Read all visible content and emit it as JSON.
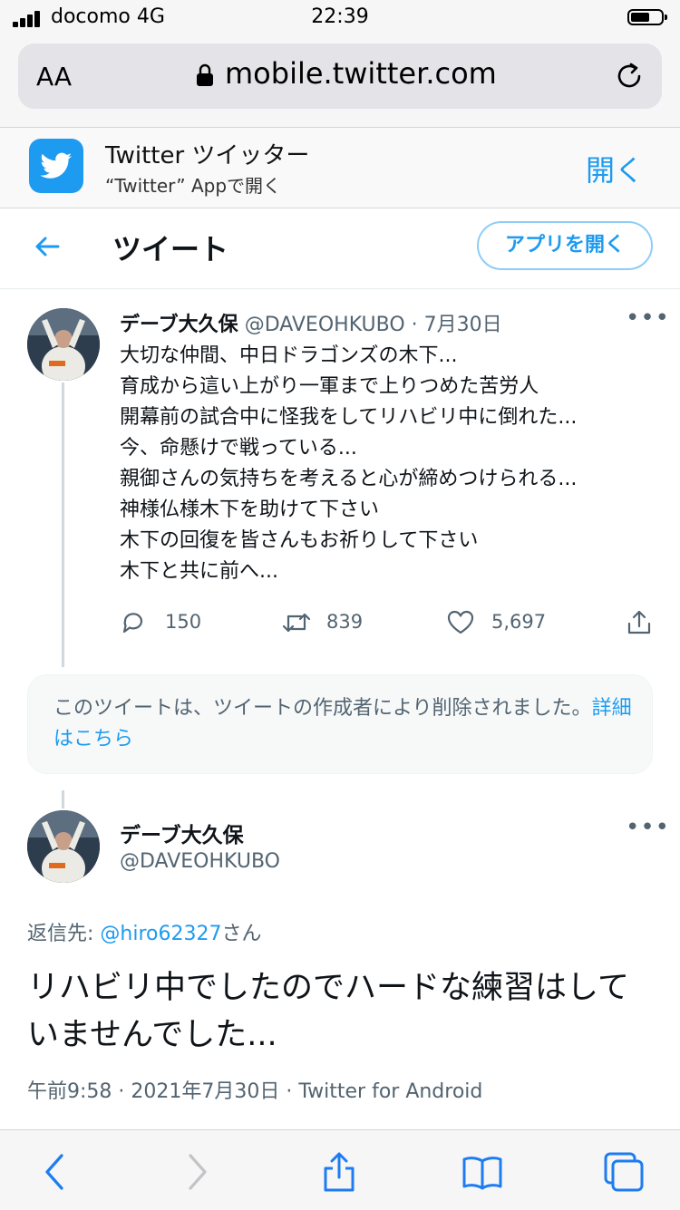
{
  "status": {
    "carrier": "docomo 4G",
    "time": "22:39"
  },
  "safari": {
    "text_size_label": "AA",
    "url": "mobile.twitter.com"
  },
  "app_banner": {
    "name": "Twitter ツイッター",
    "subtitle": "“Twitter” Appで開く",
    "open_label": "開く"
  },
  "header": {
    "title": "ツイート",
    "open_app_label": "アプリを開く"
  },
  "tweet1": {
    "author_name": "デーブ大久保",
    "handle": "@DAVEOHKUBO",
    "date": "7月30日",
    "meta": "@DAVEOHKUBO · 7月30日",
    "lines": [
      "大切な仲間、中日ドラゴンズの木下...",
      "育成から這い上がり一軍まで上りつめた苦労人",
      "開幕前の試合中に怪我をしてリハビリ中に倒れた...",
      "今、命懸けで戦っている...",
      "親御さんの気持ちを考えると心が締めつけられる...",
      "神様仏様木下を助けて下さい",
      "木下の回復を皆さんもお祈りして下さい",
      "木下と共に前へ..."
    ],
    "replies": "150",
    "retweets": "839",
    "likes": "5,697"
  },
  "deleted_notice": {
    "text": "このツイートは、ツイートの作成者により削除されました。",
    "link": "詳細はこちら"
  },
  "tweet2": {
    "author_name": "デーブ大久保",
    "handle": "@DAVEOHKUBO",
    "reply_prefix": "返信先: ",
    "reply_handle": "@hiro62327",
    "reply_suffix": "さん",
    "body": "リハビリ中でしたのでハードな練習はしていませんでした...",
    "meta": "午前9:58 · 2021年7月30日 · Twitter for Android"
  },
  "icons": [
    "signal-icon",
    "battery-icon",
    "lock-icon",
    "reload-icon",
    "twitter-bird-icon",
    "back-arrow-icon",
    "more-icon",
    "reply-icon",
    "retweet-icon",
    "like-icon",
    "share-icon",
    "safari-back-icon",
    "safari-forward-icon",
    "safari-share-icon",
    "bookmarks-icon",
    "tabs-icon"
  ],
  "colors": {
    "twitter_blue": "#1d9bf0",
    "text_primary": "#0f1419",
    "text_secondary": "#536471"
  }
}
